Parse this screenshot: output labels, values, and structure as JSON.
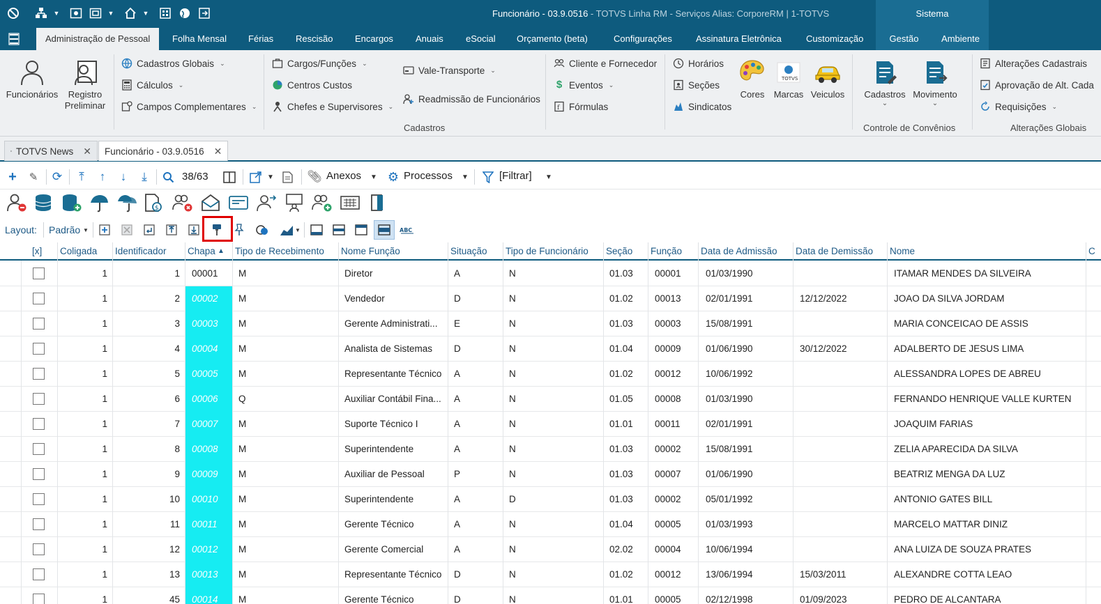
{
  "window": {
    "title": "Funcionário - 03.9.0516",
    "title_rest": " - TOTVS Linha RM - Serviços  Alias: CorporeRM | 1-TOTVS",
    "sistema": "Sistema"
  },
  "ribbon_tabs": [
    "Administração de Pessoal",
    "Folha Mensal",
    "Férias",
    "Rescisão",
    "Encargos",
    "Anuais",
    "eSocial",
    "Orçamento (beta)",
    "Configurações",
    "Assinatura Eletrônica",
    "Customização",
    "Gestão",
    "Ambiente"
  ],
  "ribbon": {
    "funcionarios": "Funcionários",
    "registro_line1": "Registro",
    "registro_line2": "Preliminar",
    "cadastros_globais": "Cadastros Globais",
    "calculos": "Cálculos",
    "campos_complementares": "Campos Complementares",
    "cargos_funcoes": "Cargos/Funções",
    "centros_custos": "Centros Custos",
    "chefes_supervisores": "Chefes e Supervisores",
    "vale_transporte": "Vale-Transporte",
    "readmissao": "Readmissão de Funcionários",
    "cliente_fornecedor": "Cliente e Fornecedor",
    "eventos": "Eventos",
    "formulas": "Fórmulas",
    "horarios": "Horários",
    "secoes": "Seções",
    "sindicatos": "Sindicatos",
    "cores": "Cores",
    "marcas": "Marcas",
    "veiculos": "Veiculos",
    "cadastros_btn": "Cadastros",
    "movimento_btn": "Movimento",
    "alteracoes_cadastrais": "Alterações Cadastrais",
    "aprovacao": "Aprovação de Alt. Cada",
    "requisicoes": "Requisições",
    "group_cadastros": "Cadastros",
    "group_convenios": "Controle de Convênios",
    "group_alteracoes": "Alterações Globais"
  },
  "doc_tabs": {
    "news": "TOTVS News",
    "funcionario": "Funcionário - 03.9.0516"
  },
  "toolbar": {
    "record_pos": "38/63",
    "anexos": "Anexos",
    "processos": "Processos",
    "filtrar": "[Filtrar]",
    "layout_label": "Layout:",
    "layout_value": "Padrão"
  },
  "grid": {
    "columns": [
      "[x]",
      "Coligada",
      "Identificador",
      "Chapa",
      "Tipo de Recebimento",
      "Nome Função",
      "Situação",
      "Tipo de Funcionário",
      "Seção",
      "Função",
      "Data de Admissão",
      "Data de Demissão",
      "Nome"
    ],
    "rows": [
      {
        "coligada": "1",
        "id": "1",
        "chapa": "00001",
        "tipo": "M",
        "funcao_nome": "Diretor",
        "situacao": "A",
        "tipo_func": "N",
        "secao": "01.03",
        "funcao": "00001",
        "admissao": "01/03/1990",
        "demissao": "",
        "nome": "ITAMAR MENDES DA SILVEIRA"
      },
      {
        "coligada": "1",
        "id": "2",
        "chapa": "00002",
        "tipo": "M",
        "funcao_nome": "Vendedor",
        "situacao": "D",
        "tipo_func": "N",
        "secao": "01.02",
        "funcao": "00013",
        "admissao": "02/01/1991",
        "demissao": "12/12/2022",
        "nome": "JOAO DA SILVA JORDAM"
      },
      {
        "coligada": "1",
        "id": "3",
        "chapa": "00003",
        "tipo": "M",
        "funcao_nome": "Gerente Administrati...",
        "situacao": "E",
        "tipo_func": "N",
        "secao": "01.03",
        "funcao": "00003",
        "admissao": "15/08/1991",
        "demissao": "",
        "nome": "MARIA CONCEICAO DE ASSIS"
      },
      {
        "coligada": "1",
        "id": "4",
        "chapa": "00004",
        "tipo": "M",
        "funcao_nome": "Analista de Sistemas",
        "situacao": "D",
        "tipo_func": "N",
        "secao": "01.04",
        "funcao": "00009",
        "admissao": "01/06/1990",
        "demissao": "30/12/2022",
        "nome": "ADALBERTO DE JESUS LIMA"
      },
      {
        "coligada": "1",
        "id": "5",
        "chapa": "00005",
        "tipo": "M",
        "funcao_nome": "Representante Técnico",
        "situacao": "A",
        "tipo_func": "N",
        "secao": "01.02",
        "funcao": "00012",
        "admissao": "10/06/1992",
        "demissao": "",
        "nome": "ALESSANDRA LOPES DE ABREU"
      },
      {
        "coligada": "1",
        "id": "6",
        "chapa": "00006",
        "tipo": "Q",
        "funcao_nome": "Auxiliar Contábil Fina...",
        "situacao": "A",
        "tipo_func": "N",
        "secao": "01.05",
        "funcao": "00008",
        "admissao": "01/03/1990",
        "demissao": "",
        "nome": "FERNANDO HENRIQUE VALLE KURTEN"
      },
      {
        "coligada": "1",
        "id": "7",
        "chapa": "00007",
        "tipo": "M",
        "funcao_nome": "Suporte Técnico I",
        "situacao": "A",
        "tipo_func": "N",
        "secao": "01.01",
        "funcao": "00011",
        "admissao": "02/01/1991",
        "demissao": "",
        "nome": "JOAQUIM FARIAS"
      },
      {
        "coligada": "1",
        "id": "8",
        "chapa": "00008",
        "tipo": "M",
        "funcao_nome": "Superintendente",
        "situacao": "A",
        "tipo_func": "N",
        "secao": "01.03",
        "funcao": "00002",
        "admissao": "15/08/1991",
        "demissao": "",
        "nome": "ZELIA APARECIDA DA SILVA"
      },
      {
        "coligada": "1",
        "id": "9",
        "chapa": "00009",
        "tipo": "M",
        "funcao_nome": "Auxiliar de Pessoal",
        "situacao": "P",
        "tipo_func": "N",
        "secao": "01.03",
        "funcao": "00007",
        "admissao": "01/06/1990",
        "demissao": "",
        "nome": "BEATRIZ MENGA DA LUZ"
      },
      {
        "coligada": "1",
        "id": "10",
        "chapa": "00010",
        "tipo": "M",
        "funcao_nome": "Superintendente",
        "situacao": "A",
        "tipo_func": "D",
        "secao": "01.03",
        "funcao": "00002",
        "admissao": "05/01/1992",
        "demissao": "",
        "nome": "ANTONIO GATES BILL"
      },
      {
        "coligada": "1",
        "id": "11",
        "chapa": "00011",
        "tipo": "M",
        "funcao_nome": "Gerente Técnico",
        "situacao": "A",
        "tipo_func": "N",
        "secao": "01.04",
        "funcao": "00005",
        "admissao": "01/03/1993",
        "demissao": "",
        "nome": "MARCELO MATTAR DINIZ"
      },
      {
        "coligada": "1",
        "id": "12",
        "chapa": "00012",
        "tipo": "M",
        "funcao_nome": "Gerente Comercial",
        "situacao": "A",
        "tipo_func": "N",
        "secao": "02.02",
        "funcao": "00004",
        "admissao": "10/06/1994",
        "demissao": "",
        "nome": "ANA LUIZA  DE SOUZA PRATES"
      },
      {
        "coligada": "1",
        "id": "13",
        "chapa": "00013",
        "tipo": "M",
        "funcao_nome": "Representante Técnico",
        "situacao": "D",
        "tipo_func": "N",
        "secao": "01.02",
        "funcao": "00012",
        "admissao": "13/06/1994",
        "demissao": "15/03/2011",
        "nome": "ALEXANDRE COTTA LEAO"
      },
      {
        "coligada": "1",
        "id": "45",
        "chapa": "00014",
        "tipo": "M",
        "funcao_nome": "Gerente Técnico",
        "situacao": "D",
        "tipo_func": "N",
        "secao": "01.01",
        "funcao": "00005",
        "admissao": "02/12/1998",
        "demissao": "01/09/2023",
        "nome": "PEDRO DE ALCANTARA"
      }
    ]
  }
}
